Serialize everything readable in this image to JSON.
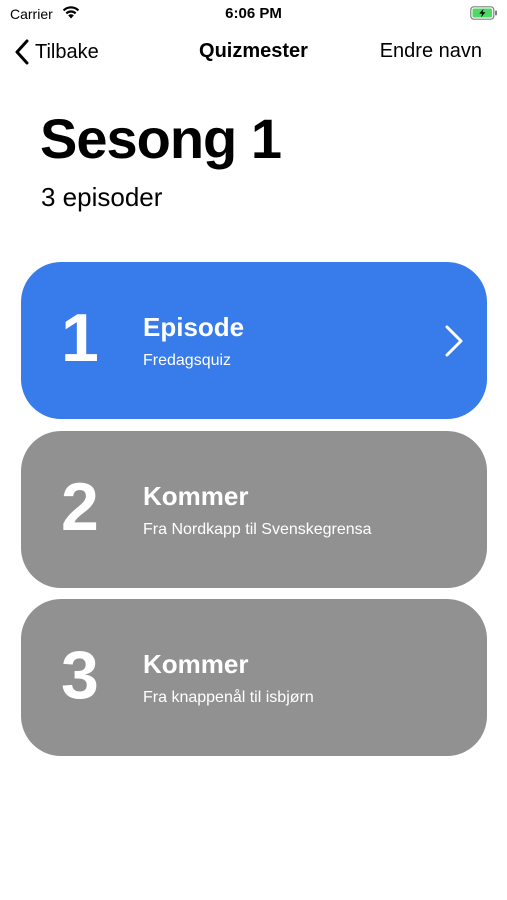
{
  "status_bar": {
    "carrier": "Carrier",
    "time": "6:06 PM",
    "wifi_icon": "wifi-icon",
    "battery_icon": "battery-charging-icon",
    "battery_color": "#4cd964"
  },
  "nav": {
    "back_label": "Tilbake",
    "title": "Quizmester",
    "rename_label": "Endre navn"
  },
  "season": {
    "title": "Sesong 1",
    "episode_count": "3 episoder"
  },
  "colors": {
    "active_card": "#387bea",
    "inactive_card": "#919191"
  },
  "episodes": [
    {
      "number": "1",
      "title": "Episode",
      "subtitle": "Fredagsquiz",
      "available": true
    },
    {
      "number": "2",
      "title": "Kommer",
      "subtitle": "Fra Nordkapp til Svenskegrensa",
      "available": false
    },
    {
      "number": "3",
      "title": "Kommer",
      "subtitle": "Fra knappenål til isbjørn",
      "available": false
    }
  ]
}
